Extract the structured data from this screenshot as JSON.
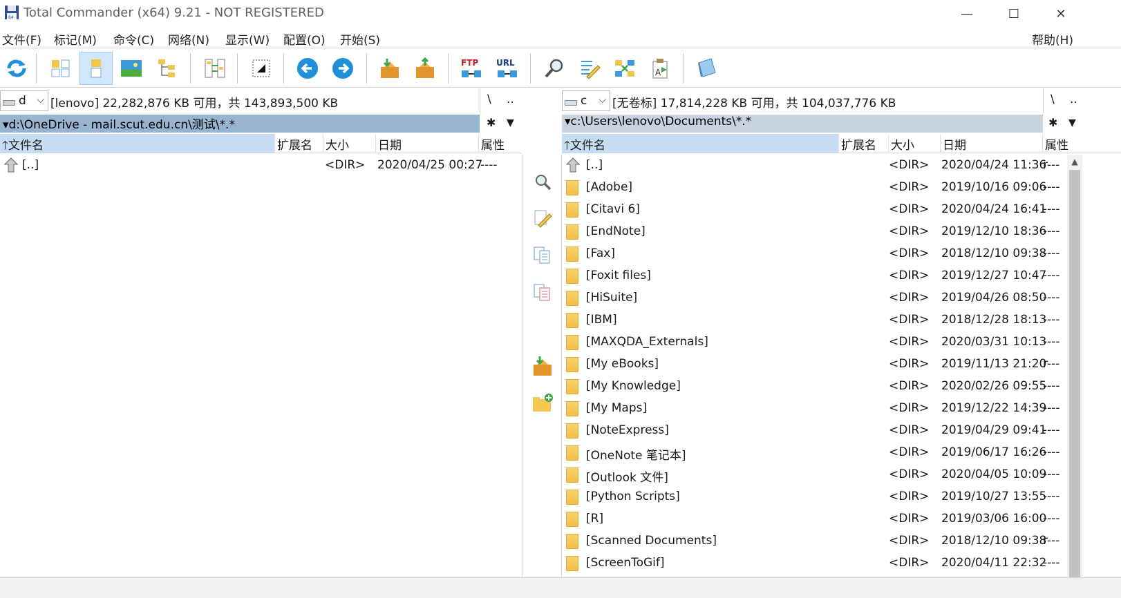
{
  "window": {
    "title": "Total Commander (x64) 9.21 - NOT REGISTERED",
    "minimize_symbol": "—",
    "maximize_symbol": "☐",
    "close_symbol": "✕"
  },
  "menu": {
    "items": [
      "文件(F)",
      "标记(M)",
      "命令(C)",
      "网络(N)",
      "显示(W)",
      "配置(O)",
      "开始(S)"
    ],
    "help": "帮助(H)"
  },
  "toolbar": {
    "ftp_label": "FTP",
    "url_label": "URL",
    "icons": [
      "refresh-icon",
      "brief-view-icon",
      "full-view-icon",
      "thumbnail-view-icon",
      "tree-view-icon",
      "compare-dirs-icon",
      "select-icon",
      "back-icon",
      "forward-icon",
      "pack-icon",
      "unpack-icon",
      "ftp-icon",
      "url-icon",
      "search-icon",
      "multi-rename-icon",
      "sync-dirs-icon",
      "edit-attrs-icon",
      "notepad-icon"
    ]
  },
  "left_panel": {
    "drive": "d",
    "drive_info": "[lenovo]  22,282,876 KB 可用，共 143,893,500 KB",
    "root": "\\",
    "up": "..",
    "path": "d:\\OneDrive - mail.scut.edu.cn\\测试\\*.*",
    "star": "✱",
    "columns": {
      "name": "文件名",
      "ext": "扩展名",
      "size": "大小",
      "date": "日期",
      "attr": "属性"
    },
    "rows": [
      {
        "name": "[..]",
        "size": "<DIR>",
        "date": "2020/04/25 00:27",
        "attr": "----",
        "icon": "up"
      }
    ]
  },
  "right_panel": {
    "drive": "c",
    "drive_info": "[无卷标]  17,814,228 KB 可用，共 104,037,776 KB",
    "root": "\\",
    "up": "..",
    "path": "c:\\Users\\lenovo\\Documents\\*.*",
    "star": "✱",
    "columns": {
      "name": "文件名",
      "ext": "扩展名",
      "size": "大小",
      "date": "日期",
      "attr": "属性"
    },
    "rows": [
      {
        "name": "[..]",
        "size": "<DIR>",
        "date": "2020/04/24 11:36",
        "attr": "r---",
        "icon": "up"
      },
      {
        "name": "[Adobe]",
        "size": "<DIR>",
        "date": "2019/10/16 09:06",
        "attr": "----",
        "icon": "folder"
      },
      {
        "name": "[Citavi 6]",
        "size": "<DIR>",
        "date": "2020/04/24 16:41",
        "attr": "----",
        "icon": "folder"
      },
      {
        "name": "[EndNote]",
        "size": "<DIR>",
        "date": "2019/12/10 18:36",
        "attr": "----",
        "icon": "folder"
      },
      {
        "name": "[Fax]",
        "size": "<DIR>",
        "date": "2018/12/10 09:38",
        "attr": "----",
        "icon": "folder"
      },
      {
        "name": "[Foxit files]",
        "size": "<DIR>",
        "date": "2019/12/27 10:47",
        "attr": "----",
        "icon": "folder"
      },
      {
        "name": "[HiSuite]",
        "size": "<DIR>",
        "date": "2019/04/26 08:50",
        "attr": "----",
        "icon": "folder"
      },
      {
        "name": "[IBM]",
        "size": "<DIR>",
        "date": "2018/12/28 18:13",
        "attr": "----",
        "icon": "folder"
      },
      {
        "name": "[MAXQDA_Externals]",
        "size": "<DIR>",
        "date": "2020/03/31 10:13",
        "attr": "----",
        "icon": "folder"
      },
      {
        "name": "[My eBooks]",
        "size": "<DIR>",
        "date": "2019/11/13 21:20",
        "attr": "r---",
        "icon": "folder"
      },
      {
        "name": "[My Knowledge]",
        "size": "<DIR>",
        "date": "2020/02/26 09:55",
        "attr": "----",
        "icon": "folder"
      },
      {
        "name": "[My Maps]",
        "size": "<DIR>",
        "date": "2019/12/22 14:39",
        "attr": "----",
        "icon": "folder"
      },
      {
        "name": "[NoteExpress]",
        "size": "<DIR>",
        "date": "2019/04/29 09:41",
        "attr": "----",
        "icon": "folder"
      },
      {
        "name": "[OneNote 笔记本]",
        "size": "<DIR>",
        "date": "2019/06/17 16:26",
        "attr": "----",
        "icon": "folder"
      },
      {
        "name": "[Outlook 文件]",
        "size": "<DIR>",
        "date": "2020/04/05 10:09",
        "attr": "----",
        "icon": "folder"
      },
      {
        "name": "[Python Scripts]",
        "size": "<DIR>",
        "date": "2019/10/27 13:55",
        "attr": "----",
        "icon": "folder"
      },
      {
        "name": "[R]",
        "size": "<DIR>",
        "date": "2019/03/06 16:00",
        "attr": "----",
        "icon": "folder"
      },
      {
        "name": "[Scanned Documents]",
        "size": "<DIR>",
        "date": "2018/12/10 09:38",
        "attr": "r---",
        "icon": "folder"
      },
      {
        "name": "[ScreenToGif]",
        "size": "<DIR>",
        "date": "2020/04/11 22:32",
        "attr": "----",
        "icon": "folder"
      }
    ]
  },
  "middle_strip": {
    "icons": [
      "view-icon",
      "edit-icon",
      "copy-icon",
      "move-icon",
      "pack-files-icon",
      "new-folder-icon"
    ]
  }
}
